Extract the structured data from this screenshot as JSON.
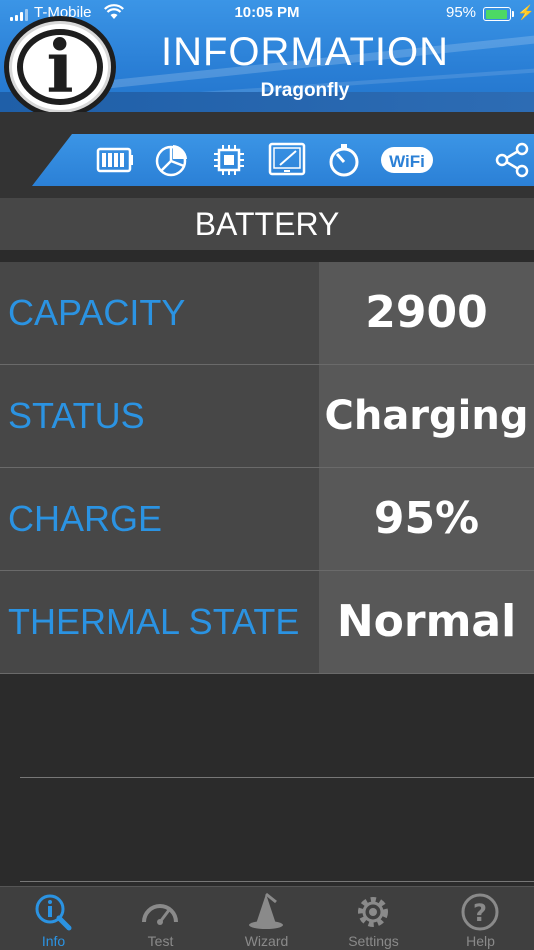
{
  "status_bar": {
    "carrier": "T-Mobile",
    "time": "10:05 PM",
    "battery_percent": "95%",
    "battery_level": 0.95,
    "battery_color": "#4cd964"
  },
  "header": {
    "logo_glyph": "i",
    "title": "INFORMATION",
    "subtitle": "Dragonfly"
  },
  "toolbar": {
    "icons": [
      "battery-icon",
      "pie-chart-icon",
      "cpu-chip-icon",
      "display-icon",
      "timer-icon",
      "wifi-icon",
      "share-icon"
    ],
    "wifi_label": "WiFi"
  },
  "section": {
    "title": "BATTERY"
  },
  "rows": [
    {
      "label": "CAPACITY",
      "value": "2900"
    },
    {
      "label": "STATUS",
      "value": "Charging"
    },
    {
      "label": "CHARGE",
      "value": "95%"
    },
    {
      "label": "THERMAL STATE",
      "value": "Normal"
    }
  ],
  "tabs": [
    {
      "label": "Info",
      "icon": "info-search-icon",
      "active": true
    },
    {
      "label": "Test",
      "icon": "speedometer-icon",
      "active": false
    },
    {
      "label": "Wizard",
      "icon": "wizard-hat-icon",
      "active": false
    },
    {
      "label": "Settings",
      "icon": "gear-icon",
      "active": false
    },
    {
      "label": "Help",
      "icon": "help-icon",
      "active": false
    }
  ],
  "colors": {
    "accent": "#2b93e2",
    "header_blue": "#2a7fd6",
    "label_bg": "#474747",
    "value_bg": "#585858",
    "background": "#2b2b2b"
  }
}
